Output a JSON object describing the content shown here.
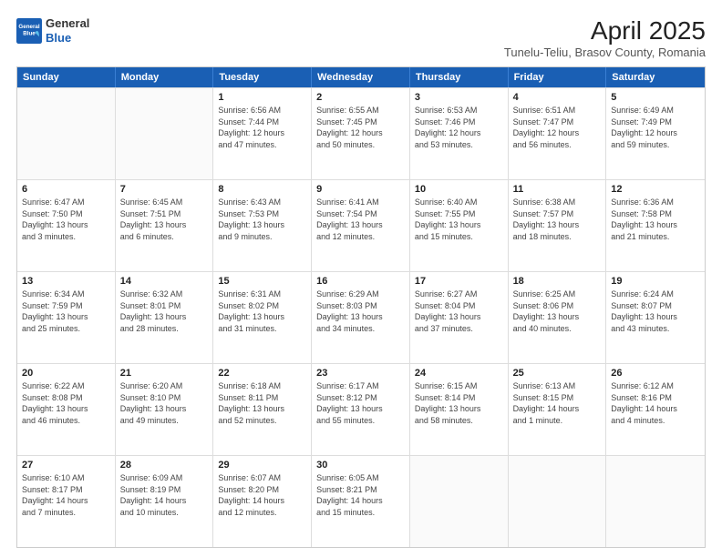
{
  "header": {
    "logo_general": "General",
    "logo_blue": "Blue",
    "month_title": "April 2025",
    "location": "Tunelu-Teliu, Brasov County, Romania"
  },
  "calendar": {
    "days_of_week": [
      "Sunday",
      "Monday",
      "Tuesday",
      "Wednesday",
      "Thursday",
      "Friday",
      "Saturday"
    ],
    "rows": [
      [
        {
          "day": "",
          "text": ""
        },
        {
          "day": "",
          "text": ""
        },
        {
          "day": "1",
          "text": "Sunrise: 6:56 AM\nSunset: 7:44 PM\nDaylight: 12 hours\nand 47 minutes."
        },
        {
          "day": "2",
          "text": "Sunrise: 6:55 AM\nSunset: 7:45 PM\nDaylight: 12 hours\nand 50 minutes."
        },
        {
          "day": "3",
          "text": "Sunrise: 6:53 AM\nSunset: 7:46 PM\nDaylight: 12 hours\nand 53 minutes."
        },
        {
          "day": "4",
          "text": "Sunrise: 6:51 AM\nSunset: 7:47 PM\nDaylight: 12 hours\nand 56 minutes."
        },
        {
          "day": "5",
          "text": "Sunrise: 6:49 AM\nSunset: 7:49 PM\nDaylight: 12 hours\nand 59 minutes."
        }
      ],
      [
        {
          "day": "6",
          "text": "Sunrise: 6:47 AM\nSunset: 7:50 PM\nDaylight: 13 hours\nand 3 minutes."
        },
        {
          "day": "7",
          "text": "Sunrise: 6:45 AM\nSunset: 7:51 PM\nDaylight: 13 hours\nand 6 minutes."
        },
        {
          "day": "8",
          "text": "Sunrise: 6:43 AM\nSunset: 7:53 PM\nDaylight: 13 hours\nand 9 minutes."
        },
        {
          "day": "9",
          "text": "Sunrise: 6:41 AM\nSunset: 7:54 PM\nDaylight: 13 hours\nand 12 minutes."
        },
        {
          "day": "10",
          "text": "Sunrise: 6:40 AM\nSunset: 7:55 PM\nDaylight: 13 hours\nand 15 minutes."
        },
        {
          "day": "11",
          "text": "Sunrise: 6:38 AM\nSunset: 7:57 PM\nDaylight: 13 hours\nand 18 minutes."
        },
        {
          "day": "12",
          "text": "Sunrise: 6:36 AM\nSunset: 7:58 PM\nDaylight: 13 hours\nand 21 minutes."
        }
      ],
      [
        {
          "day": "13",
          "text": "Sunrise: 6:34 AM\nSunset: 7:59 PM\nDaylight: 13 hours\nand 25 minutes."
        },
        {
          "day": "14",
          "text": "Sunrise: 6:32 AM\nSunset: 8:01 PM\nDaylight: 13 hours\nand 28 minutes."
        },
        {
          "day": "15",
          "text": "Sunrise: 6:31 AM\nSunset: 8:02 PM\nDaylight: 13 hours\nand 31 minutes."
        },
        {
          "day": "16",
          "text": "Sunrise: 6:29 AM\nSunset: 8:03 PM\nDaylight: 13 hours\nand 34 minutes."
        },
        {
          "day": "17",
          "text": "Sunrise: 6:27 AM\nSunset: 8:04 PM\nDaylight: 13 hours\nand 37 minutes."
        },
        {
          "day": "18",
          "text": "Sunrise: 6:25 AM\nSunset: 8:06 PM\nDaylight: 13 hours\nand 40 minutes."
        },
        {
          "day": "19",
          "text": "Sunrise: 6:24 AM\nSunset: 8:07 PM\nDaylight: 13 hours\nand 43 minutes."
        }
      ],
      [
        {
          "day": "20",
          "text": "Sunrise: 6:22 AM\nSunset: 8:08 PM\nDaylight: 13 hours\nand 46 minutes."
        },
        {
          "day": "21",
          "text": "Sunrise: 6:20 AM\nSunset: 8:10 PM\nDaylight: 13 hours\nand 49 minutes."
        },
        {
          "day": "22",
          "text": "Sunrise: 6:18 AM\nSunset: 8:11 PM\nDaylight: 13 hours\nand 52 minutes."
        },
        {
          "day": "23",
          "text": "Sunrise: 6:17 AM\nSunset: 8:12 PM\nDaylight: 13 hours\nand 55 minutes."
        },
        {
          "day": "24",
          "text": "Sunrise: 6:15 AM\nSunset: 8:14 PM\nDaylight: 13 hours\nand 58 minutes."
        },
        {
          "day": "25",
          "text": "Sunrise: 6:13 AM\nSunset: 8:15 PM\nDaylight: 14 hours\nand 1 minute."
        },
        {
          "day": "26",
          "text": "Sunrise: 6:12 AM\nSunset: 8:16 PM\nDaylight: 14 hours\nand 4 minutes."
        }
      ],
      [
        {
          "day": "27",
          "text": "Sunrise: 6:10 AM\nSunset: 8:17 PM\nDaylight: 14 hours\nand 7 minutes."
        },
        {
          "day": "28",
          "text": "Sunrise: 6:09 AM\nSunset: 8:19 PM\nDaylight: 14 hours\nand 10 minutes."
        },
        {
          "day": "29",
          "text": "Sunrise: 6:07 AM\nSunset: 8:20 PM\nDaylight: 14 hours\nand 12 minutes."
        },
        {
          "day": "30",
          "text": "Sunrise: 6:05 AM\nSunset: 8:21 PM\nDaylight: 14 hours\nand 15 minutes."
        },
        {
          "day": "",
          "text": ""
        },
        {
          "day": "",
          "text": ""
        },
        {
          "day": "",
          "text": ""
        }
      ]
    ]
  }
}
